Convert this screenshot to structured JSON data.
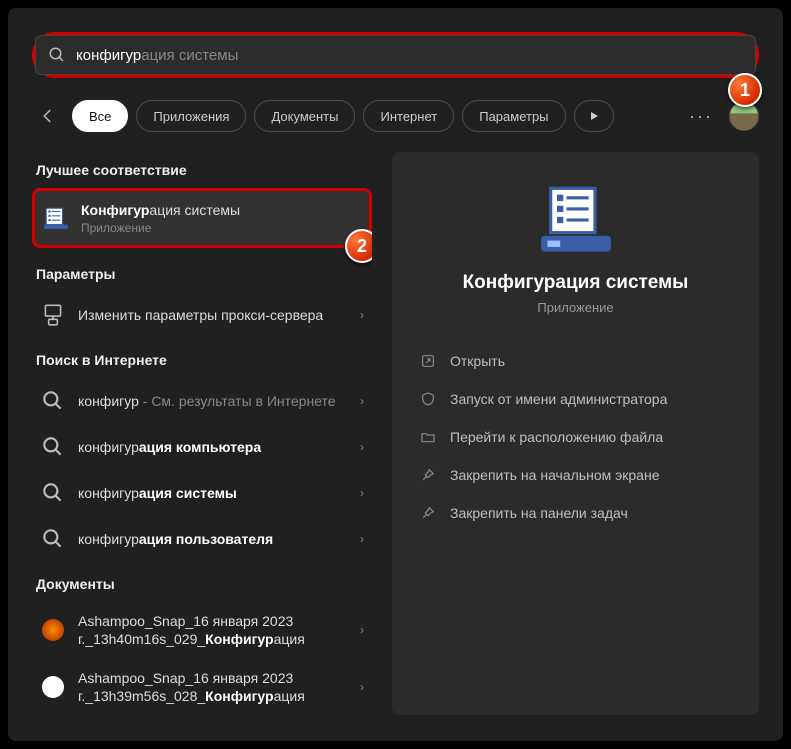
{
  "search": {
    "prefix": "конфигур",
    "suffix": "ация системы"
  },
  "filters": {
    "all": "Все",
    "apps": "Приложения",
    "docs": "Документы",
    "web": "Интернет",
    "settings": "Параметры"
  },
  "callouts": {
    "one": "1",
    "two": "2"
  },
  "sections": {
    "best": "Лучшее соответствие",
    "settings": "Параметры",
    "web": "Поиск в Интернете",
    "docs": "Документы"
  },
  "best": {
    "title_prefix": "Конфигур",
    "title_suffix": "ация системы",
    "sub": "Приложение"
  },
  "settings_results": [
    {
      "title": "Изменить параметры прокси-сервера"
    }
  ],
  "web_results": [
    {
      "prefix": "конфигур",
      "suffix": " - См. результаты в Интернете"
    },
    {
      "prefix": "конфигур",
      "suffix": "ация компьютера"
    },
    {
      "prefix": "конфигур",
      "suffix": "ация системы"
    },
    {
      "prefix": "конфигур",
      "suffix": "ация пользователя"
    }
  ],
  "doc_results": [
    {
      "line1": "Ashampoo_Snap_16 января 2023",
      "line2_pre": "г._13h40m16s_029_",
      "line2_bold": "Конфигур",
      "line2_post": "ация"
    },
    {
      "line1": "Ashampoo_Snap_16 января 2023",
      "line2_pre": "г._13h39m56s_028_",
      "line2_bold": "Конфигур",
      "line2_post": "ация"
    }
  ],
  "right_panel": {
    "title": "Конфигурация системы",
    "sub": "Приложение",
    "actions": {
      "open": "Открыть",
      "admin": "Запуск от имени администратора",
      "location": "Перейти к расположению файла",
      "pin_start": "Закрепить на начальном экране",
      "pin_taskbar": "Закрепить на панели задач"
    }
  }
}
